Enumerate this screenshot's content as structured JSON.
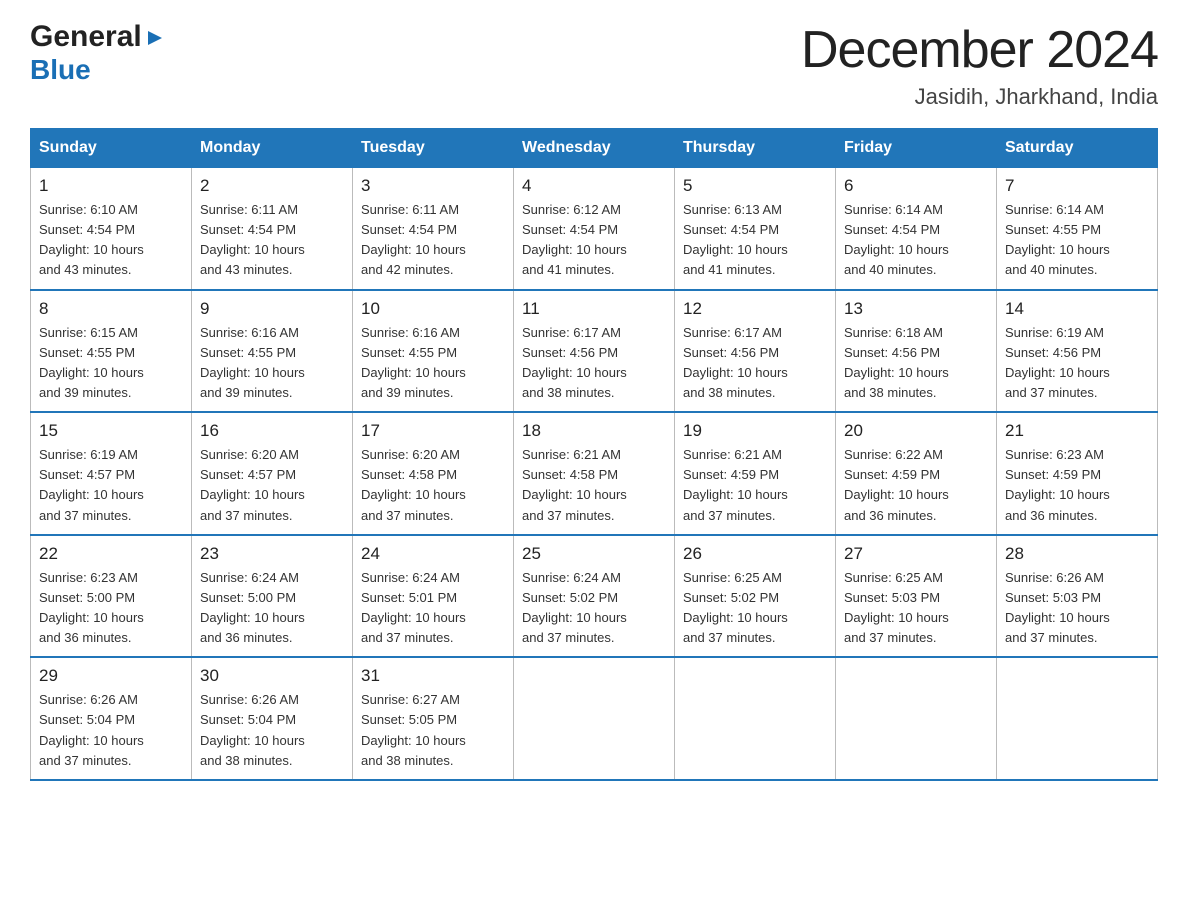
{
  "header": {
    "logo_line1": "General",
    "logo_line2": "Blue",
    "month": "December 2024",
    "location": "Jasidih, Jharkhand, India"
  },
  "days_of_week": [
    "Sunday",
    "Monday",
    "Tuesday",
    "Wednesday",
    "Thursday",
    "Friday",
    "Saturday"
  ],
  "weeks": [
    [
      {
        "day": "1",
        "sunrise": "6:10 AM",
        "sunset": "4:54 PM",
        "daylight": "10 hours and 43 minutes."
      },
      {
        "day": "2",
        "sunrise": "6:11 AM",
        "sunset": "4:54 PM",
        "daylight": "10 hours and 43 minutes."
      },
      {
        "day": "3",
        "sunrise": "6:11 AM",
        "sunset": "4:54 PM",
        "daylight": "10 hours and 42 minutes."
      },
      {
        "day": "4",
        "sunrise": "6:12 AM",
        "sunset": "4:54 PM",
        "daylight": "10 hours and 41 minutes."
      },
      {
        "day": "5",
        "sunrise": "6:13 AM",
        "sunset": "4:54 PM",
        "daylight": "10 hours and 41 minutes."
      },
      {
        "day": "6",
        "sunrise": "6:14 AM",
        "sunset": "4:54 PM",
        "daylight": "10 hours and 40 minutes."
      },
      {
        "day": "7",
        "sunrise": "6:14 AM",
        "sunset": "4:55 PM",
        "daylight": "10 hours and 40 minutes."
      }
    ],
    [
      {
        "day": "8",
        "sunrise": "6:15 AM",
        "sunset": "4:55 PM",
        "daylight": "10 hours and 39 minutes."
      },
      {
        "day": "9",
        "sunrise": "6:16 AM",
        "sunset": "4:55 PM",
        "daylight": "10 hours and 39 minutes."
      },
      {
        "day": "10",
        "sunrise": "6:16 AM",
        "sunset": "4:55 PM",
        "daylight": "10 hours and 39 minutes."
      },
      {
        "day": "11",
        "sunrise": "6:17 AM",
        "sunset": "4:56 PM",
        "daylight": "10 hours and 38 minutes."
      },
      {
        "day": "12",
        "sunrise": "6:17 AM",
        "sunset": "4:56 PM",
        "daylight": "10 hours and 38 minutes."
      },
      {
        "day": "13",
        "sunrise": "6:18 AM",
        "sunset": "4:56 PM",
        "daylight": "10 hours and 38 minutes."
      },
      {
        "day": "14",
        "sunrise": "6:19 AM",
        "sunset": "4:56 PM",
        "daylight": "10 hours and 37 minutes."
      }
    ],
    [
      {
        "day": "15",
        "sunrise": "6:19 AM",
        "sunset": "4:57 PM",
        "daylight": "10 hours and 37 minutes."
      },
      {
        "day": "16",
        "sunrise": "6:20 AM",
        "sunset": "4:57 PM",
        "daylight": "10 hours and 37 minutes."
      },
      {
        "day": "17",
        "sunrise": "6:20 AM",
        "sunset": "4:58 PM",
        "daylight": "10 hours and 37 minutes."
      },
      {
        "day": "18",
        "sunrise": "6:21 AM",
        "sunset": "4:58 PM",
        "daylight": "10 hours and 37 minutes."
      },
      {
        "day": "19",
        "sunrise": "6:21 AM",
        "sunset": "4:59 PM",
        "daylight": "10 hours and 37 minutes."
      },
      {
        "day": "20",
        "sunrise": "6:22 AM",
        "sunset": "4:59 PM",
        "daylight": "10 hours and 36 minutes."
      },
      {
        "day": "21",
        "sunrise": "6:23 AM",
        "sunset": "4:59 PM",
        "daylight": "10 hours and 36 minutes."
      }
    ],
    [
      {
        "day": "22",
        "sunrise": "6:23 AM",
        "sunset": "5:00 PM",
        "daylight": "10 hours and 36 minutes."
      },
      {
        "day": "23",
        "sunrise": "6:24 AM",
        "sunset": "5:00 PM",
        "daylight": "10 hours and 36 minutes."
      },
      {
        "day": "24",
        "sunrise": "6:24 AM",
        "sunset": "5:01 PM",
        "daylight": "10 hours and 37 minutes."
      },
      {
        "day": "25",
        "sunrise": "6:24 AM",
        "sunset": "5:02 PM",
        "daylight": "10 hours and 37 minutes."
      },
      {
        "day": "26",
        "sunrise": "6:25 AM",
        "sunset": "5:02 PM",
        "daylight": "10 hours and 37 minutes."
      },
      {
        "day": "27",
        "sunrise": "6:25 AM",
        "sunset": "5:03 PM",
        "daylight": "10 hours and 37 minutes."
      },
      {
        "day": "28",
        "sunrise": "6:26 AM",
        "sunset": "5:03 PM",
        "daylight": "10 hours and 37 minutes."
      }
    ],
    [
      {
        "day": "29",
        "sunrise": "6:26 AM",
        "sunset": "5:04 PM",
        "daylight": "10 hours and 37 minutes."
      },
      {
        "day": "30",
        "sunrise": "6:26 AM",
        "sunset": "5:04 PM",
        "daylight": "10 hours and 38 minutes."
      },
      {
        "day": "31",
        "sunrise": "6:27 AM",
        "sunset": "5:05 PM",
        "daylight": "10 hours and 38 minutes."
      },
      null,
      null,
      null,
      null
    ]
  ],
  "labels": {
    "sunrise": "Sunrise:",
    "sunset": "Sunset:",
    "daylight": "Daylight:"
  }
}
